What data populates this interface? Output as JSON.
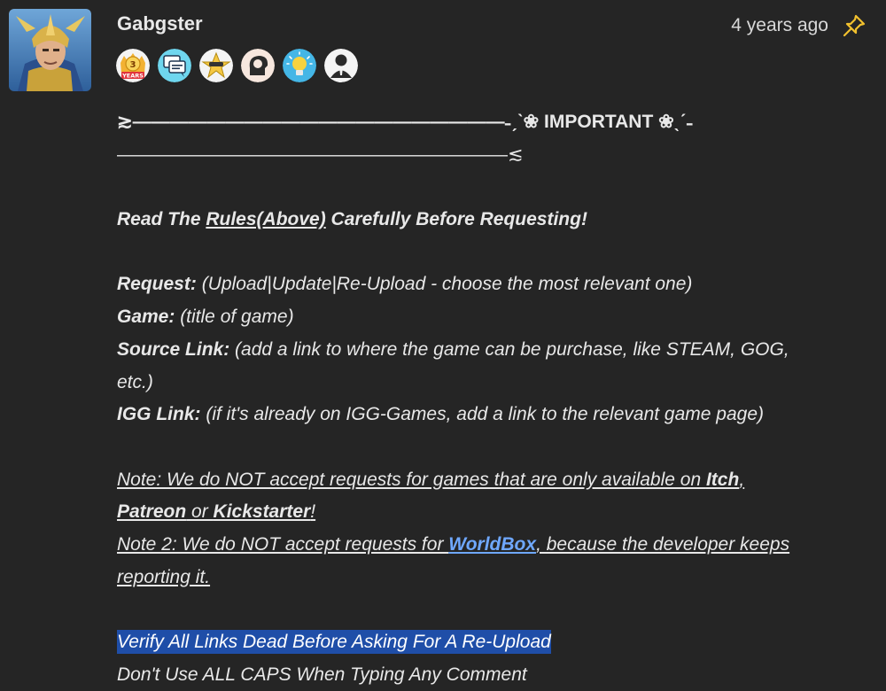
{
  "comment": {
    "username": "Gabgster",
    "timestamp": "4 years ago",
    "badges": [
      {
        "icon": "three-years-badge-icon",
        "label": "3",
        "sub": "YEARS"
      },
      {
        "icon": "chat-badge-icon"
      },
      {
        "icon": "star-badge-icon"
      },
      {
        "icon": "mind-badge-icon"
      },
      {
        "icon": "idea-badge-icon"
      },
      {
        "icon": "person-badge-icon"
      }
    ],
    "header_line1_prefix": "≳————————————————————",
    "header_line1_deco_left": "˗ˏˋ❀",
    "header_important": "IMPORTANT",
    "header_line1_deco_right": "❀ˎˊ˗",
    "header_line2": "—————————————————————≲",
    "read_pre": "Read The ",
    "read_link": "Rules(Above)",
    "read_post": " Carefully Before Requesting!",
    "request_label": "Request:",
    "request_text": " (Upload|Update|Re-Upload - choose the most relevant one)",
    "game_label": "Game:",
    "game_text": " (title of game)",
    "source_label": "Source Link:",
    "source_text_1": " (add a link to where the game can be purchase, like STEAM, GOG,",
    "source_text_2": "etc.)",
    "igg_label": "IGG Link:",
    "igg_text": " (if it's already on IGG-Games, add a link to the relevant game page)",
    "note1_a": "Note: We do NOT accept requests for games that are only available on ",
    "note1_itch": "Itch",
    "note1_comma": ",",
    "note1_patreon": "Patreon",
    "note1_or": " or ",
    "note1_kick": "Kickstarter",
    "note1_end": "!",
    "note2_a": "Note 2: We do NOT accept requests for ",
    "note2_link": "WorldBox",
    "note2_b": ", because the developer keeps",
    "note2_c": "reporting it.",
    "verify": "Verify All Links Dead Before Asking For A Re-Upload",
    "caps": "Don't Use ALL CAPS When Typing Any Comment"
  },
  "colors": {
    "background": "#252525",
    "text": "#e8e8e8",
    "link": "#6fa8ff",
    "selection": "#1f4ea8",
    "pin": "#f2c12e"
  }
}
